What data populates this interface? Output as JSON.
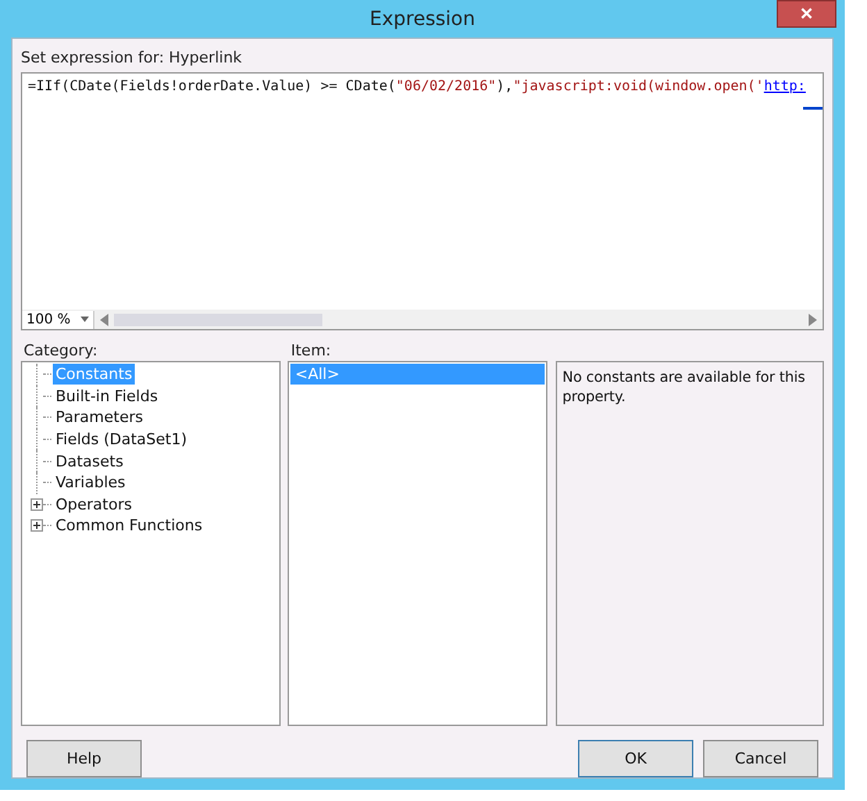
{
  "window": {
    "title": "Expression",
    "close": "✕"
  },
  "prompt": "Set expression for: Hyperlink",
  "expression": [
    {
      "text": "=IIf(CDate(Fields!orderDate.Value) >= CDate(",
      "kind": "code"
    },
    {
      "text": "\"06/02/2016\"",
      "kind": "string"
    },
    {
      "text": "),",
      "kind": "code"
    },
    {
      "text": "\"javascript:void(window.open('",
      "kind": "string"
    },
    {
      "text": "http:",
      "kind": "link"
    }
  ],
  "zoom": {
    "value": "100 %"
  },
  "category": {
    "label": "Category:",
    "items": [
      {
        "label": "Constants",
        "selected": true,
        "expandable": false
      },
      {
        "label": "Built-in Fields",
        "selected": false,
        "expandable": false
      },
      {
        "label": "Parameters",
        "selected": false,
        "expandable": false
      },
      {
        "label": "Fields (DataSet1)",
        "selected": false,
        "expandable": false
      },
      {
        "label": "Datasets",
        "selected": false,
        "expandable": false
      },
      {
        "label": "Variables",
        "selected": false,
        "expandable": false
      },
      {
        "label": "Operators",
        "selected": false,
        "expandable": true
      },
      {
        "label": "Common Functions",
        "selected": false,
        "expandable": true
      }
    ]
  },
  "item": {
    "label": "Item:",
    "items": [
      {
        "label": "<All>",
        "selected": true
      }
    ]
  },
  "description": "No constants are available for this property.",
  "buttons": [
    {
      "label": "Help",
      "kind": "left",
      "default": false
    },
    {
      "label": "OK",
      "kind": "right",
      "default": true
    },
    {
      "label": "Cancel",
      "kind": "right",
      "default": false
    }
  ]
}
